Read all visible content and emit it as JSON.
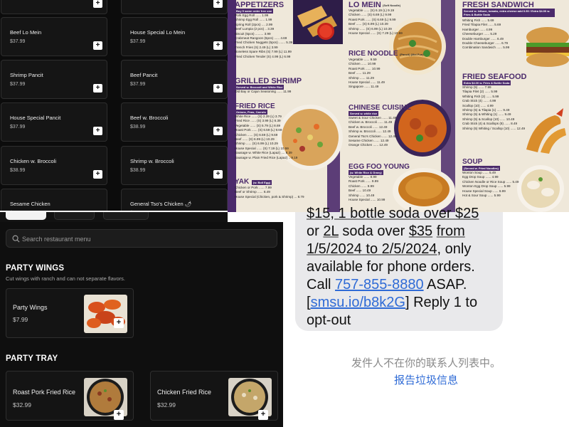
{
  "top_left": {
    "cards": [
      {
        "name": "",
        "price": ""
      },
      {
        "name": "",
        "price": ""
      },
      {
        "name": "Beef Lo Mein",
        "price": "$37.99"
      },
      {
        "name": "House Special Lo Mein",
        "price": "$37.99"
      },
      {
        "name": "Shrimp Pancit",
        "price": "$37.99"
      },
      {
        "name": "Beef Pancit",
        "price": "$37.99"
      },
      {
        "name": "House Special Pancit",
        "price": "$37.99"
      },
      {
        "name": "Beef w. Broccoli",
        "price": "$38.99"
      },
      {
        "name": "Chicken w. Broccoli",
        "price": "$38.99"
      },
      {
        "name": "Shrimp w. Broccoli",
        "price": "$38.99"
      },
      {
        "name": "Sesame Chicken",
        "price": "$38.99"
      },
      {
        "name": "General Tso's Chicken 🌶",
        "price": "$38.99"
      }
    ],
    "add_label": "+"
  },
  "menu_poster": {
    "appetizers": {
      "title": "APPETIZERS",
      "sub": "Buy 5 same order free one",
      "items": [
        "Pork Egg Roll ...... 1.99",
        "Shrimp Egg Roll ...... 1.99",
        "Spring Roll (2pcs) .... 2.99",
        "Beef Lumpia (2 pcs) .. 3.39",
        "Biscuit (5pcs) ......... 3.99",
        "Crabmeat Rangoon (6pcs) ...... 4.69",
        "Fried Chicken Nuggets (5pcs) ....... 5.39",
        "French Fries (S) 2.49 (L) 3.99",
        "Boneless Spare Ribs (S) 7.99 (L) 11.99",
        "Fried Chicken Tender (S) 4.99 (L) 6.99"
      ]
    },
    "grilled_shrimp": {
      "title": "GRILLED SHRIMP",
      "sub": "Served w. Broccoli and White Rice",
      "items": [
        "Old Bay or Cajun Seasoning ...... 11.99"
      ]
    },
    "fried_rice": {
      "title": "FRIED RICE",
      "sub": "Onions, Peas, Carrots",
      "items": [
        "White Rice ...... (S) 2.39 (L) 3.79",
        "Fried Rice ...... (S) 3.99 (L) 6.39",
        "Vegetable ...... (S) 5.79 (L) 8.69",
        "Roast Pork ...... (S) 6.59 (L) 9.69",
        "Chicken ...... (S) 6.59 (L) 9.69",
        "Beef ...... (S) 6.99 (L) 10.29",
        "Shrimp ...... (S) 6.99 (L) 10.29",
        "House Special ...... (S) 7.19 (L) 10.59",
        "Sausage w. White Rice (Lapaz) .... 8.39",
        "Sausage w. Plain Fried Rice (Lapaz) .. 9.19"
      ]
    },
    "yak": {
      "title": "YAK",
      "sub": "(w. Boil Egg)",
      "items": [
        "Chicken or Pork ...... 7.99",
        "Beef or Shrimp ...... 8.49",
        "House Special (Chicken, pork & Shrimp) ... 8.79"
      ]
    },
    "lo_mein": {
      "title": "LO MEIN",
      "sub": "(Soft Noodle)",
      "items": [
        "Vegetable ...... (S) 6.19 (L) 9.19",
        "Chicken ...... (S) 6.69 (L) 9.99",
        "Roast Pork ...... (S) 6.69 (L) 9.99",
        "Beef ...... (S) 6.99 (L) 10.39",
        "Shrimp ...... (S) 6.99 (L) 10.39",
        "House Special ...... (S) 7.29 (L) 10.59"
      ]
    },
    "rice_noodle": {
      "title": "RICE NOODLE",
      "sub": "(Pancit) (Mei Fun)",
      "items": [
        "Vegetable ...... 9.59",
        "Chicken ...... 10.99",
        "Roast Pork ...... 10.99",
        "Beef ...... 11.29",
        "Shrimp ...... 11.29",
        "House Special ...... 11.49",
        "Singapore ...... 11.49"
      ]
    },
    "chinese_cuisine": {
      "title": "CHINESE CUISINE",
      "sub": "Served w. white rice",
      "items": [
        "Sweet & Sour Chicken ...... 11.49",
        "Chicken w. Broccoli ...... 11.49",
        "Beef w. Broccoli ...... 12.49",
        "Shrimp w. Broccoli ...... 12.49",
        "General Tso's Chicken ...... 12.49",
        "Sesame Chicken ...... 12.49",
        "Orange Chicken ...... 12.49"
      ]
    },
    "egg_foo_young": {
      "title": "EGG FOO YOUNG",
      "sub": "(w. White Rice & Gravy)",
      "items": [
        "Vegetable ...... 8.99",
        "Roast Pork ...... 9.99",
        "Chicken ...... 9.99",
        "Beef ...... 10.49",
        "Shrimp ...... 10.49",
        "House Special ...... 10.99"
      ]
    },
    "fresh_sandwich": {
      "title": "FRESH SANDWICH",
      "sub": "Served w. lettuce, tomato, extra cheese add 0.50 / Extra $4.00 w. Fries & Bottle Soda",
      "items": [
        "Whiting Fish ...... 5.69",
        "Fried Tilapia Filet ...... 5.69",
        "Hamburger ...... 4.99",
        "Cheeseburger ...... 5.29",
        "Double Hamburger ...... 6.49",
        "Double Cheeseburger ...... 6.79",
        "Combination Sandwich ...... 5.99"
      ]
    },
    "fried_seafood": {
      "title": "FRIED SEAFOOD",
      "sub": "Extra $4.00 w. Fries & Bottle Soda",
      "items": [
        "Shrimp (5) ...... 7.99",
        "Tilapia Filet (2) ...... 5.99",
        "Whiting Fish (2) ...... 5.99",
        "Crab Stick (4) ...... 4.99",
        "Scallop (10) ...... 4.99",
        "Shrimp (5) & Tilapia (1) ...... 9.49",
        "Shrimp (5) & Whiting (1) ...... 9.49",
        "Shrimp (5) & Scallop (10) ...... 10.49",
        "Crab Stick (4) & Scallops (8) ...... 8.49",
        "Shrimp (5) Whiting / Scallop (10) ...... 12.49"
      ]
    },
    "soup": {
      "title": "SOUP",
      "sub": "(Served w. Fried Noodles)",
      "items": [
        "Wonton Soup ...... 5.49",
        "Egg Drop Soup ...... 4.99",
        "Chicken Noodle or Rice Soup ...... 5.49",
        "Wonton Egg Drop Soup ...... 5.99",
        "House Special Soup ...... 6.99",
        "Hot & Sour Soup ...... 5.99"
      ]
    }
  },
  "bottom_left": {
    "search_placeholder": "Search restaurant menu",
    "party_wings": {
      "title": "PARTY WINGS",
      "desc": "Cut wings with ranch and can not separate flavors.",
      "items": [
        {
          "name": "Party Wings",
          "price": "$7.99"
        }
      ]
    },
    "party_tray": {
      "title": "PARTY TRAY",
      "items": [
        {
          "name": "Roast Pork Fried Rice",
          "price": "$32.99"
        },
        {
          "name": "Chicken Fried Rice",
          "price": "$32.99"
        }
      ]
    },
    "add_label": "+"
  },
  "sms": {
    "line1_a": "$15, 1 bottle soda over $25",
    "line2_a": "or ",
    "line2_b": "2L",
    "line2_c": " soda over ",
    "line2_d": "$35",
    "line2_e": " ",
    "line2_f": "from",
    "line3_a": "1/5/2024",
    "line3_b": " to ",
    "line3_c": "2/5/2024",
    "line3_d": ",  only",
    "line4": "available for phone orders.",
    "line5_a": "Call ",
    "line5_phone": "757-855-8880",
    "line5_b": " ASAP.",
    "line6_a": "[",
    "line6_link": "smsu.io/b8k2G",
    "line6_b": "] Reply 1 to",
    "line7": "opt-out",
    "unknown_sender": "发件人不在你的联系人列表中。",
    "report_junk": "报告垃圾信息"
  },
  "colors": {
    "dark_bg": "#0f0f0f",
    "poster_bg": "#efe8da",
    "poster_accent": "#4b2a6b",
    "sms_bubble": "#e9e9eb",
    "link": "#2f6bd6"
  }
}
